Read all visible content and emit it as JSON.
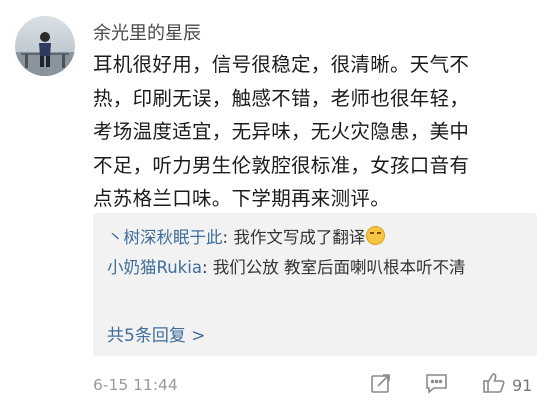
{
  "comment": {
    "username": "余光里的星辰",
    "lines": [
      "耳机很好用，信号很稳定，很清晰。天气不",
      "热，印刷无误，触感不错，老师也很年轻，",
      "考场温度适宜，无异味，无火灾隐患，美中",
      "不足，听力男生伦敦腔很标准，女孩口音有",
      "点苏格兰口味。下学期再来测评。"
    ],
    "time": "6-15 11:44",
    "likes": "91"
  },
  "replies": [
    {
      "name": "丶树深秋眠于此",
      "text": "我作文写成了翻译",
      "emoji": "sweat-smile-emoji"
    },
    {
      "name": "小奶猫Rukia",
      "text": "我们公放 教室后面喇叭根本听不清"
    }
  ],
  "more_replies": "共5条回复 >",
  "icons": {
    "share": "share-icon",
    "comment": "comment-icon",
    "like": "thumbs-up-icon"
  },
  "colors": {
    "link": "#3f6e9a",
    "reply_bg": "#f2f2f2",
    "meta": "#9a9a9a"
  }
}
